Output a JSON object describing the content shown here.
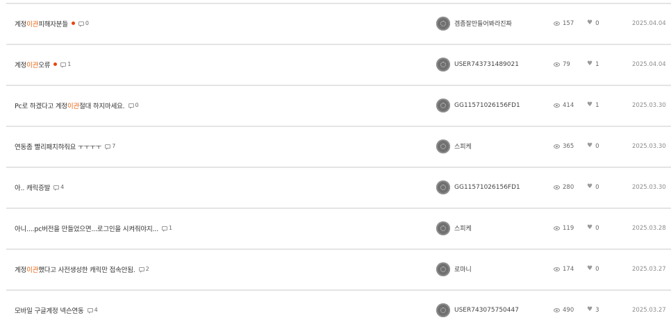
{
  "colors": {
    "highlight": "#e8620f",
    "new_dot": "#e8450e",
    "divider": "#e4e4e4"
  },
  "posts": [
    {
      "title_pre": "계정",
      "title_hl": "이관",
      "title_post": " 피해자분들",
      "is_new": true,
      "comments": "0",
      "author": "겜좀잘만들어봐라진짜",
      "views": "157",
      "likes": "0",
      "date": "2025.04.04"
    },
    {
      "title_pre": "계정",
      "title_hl": "이관",
      "title_post": "오류",
      "is_new": true,
      "comments": "1",
      "author": "USER743731489021",
      "views": "79",
      "likes": "1",
      "date": "2025.04.04"
    },
    {
      "title_pre": "Pc로 하겠다고 계정",
      "title_hl": "이관",
      "title_post": " 절대 하지마세요.",
      "is_new": false,
      "comments": "0",
      "author": "GG11571026156FD1",
      "views": "414",
      "likes": "1",
      "date": "2025.03.30"
    },
    {
      "title_pre": "연동좀 빨리패치햐줘요 ㅜㅜㅜㅜ",
      "title_hl": "",
      "title_post": "",
      "is_new": false,
      "comments": "7",
      "author": "스피케",
      "views": "365",
      "likes": "0",
      "date": "2025.03.30"
    },
    {
      "title_pre": "아.. 캐릭증발",
      "title_hl": "",
      "title_post": "",
      "is_new": false,
      "comments": "4",
      "author": "GG11571026156FD1",
      "views": "280",
      "likes": "0",
      "date": "2025.03.30"
    },
    {
      "title_pre": "아니....pc버전을 만들었으면...로그인을 시켜줘야지...",
      "title_hl": "",
      "title_post": "",
      "is_new": false,
      "comments": "1",
      "author": "스피케",
      "views": "119",
      "likes": "0",
      "date": "2025.03.28"
    },
    {
      "title_pre": "계정",
      "title_hl": "이관",
      "title_post": "했다고 사전생성한 캐릭만 접속안됨.",
      "is_new": false,
      "comments": "2",
      "author": "로마니",
      "views": "174",
      "likes": "0",
      "date": "2025.03.27"
    },
    {
      "title_pre": "모바일 구글계정 넥슨연동",
      "title_hl": "",
      "title_post": "",
      "is_new": false,
      "comments": "4",
      "author": "USER743075750447",
      "views": "490",
      "likes": "3",
      "date": "2025.03.27"
    }
  ]
}
